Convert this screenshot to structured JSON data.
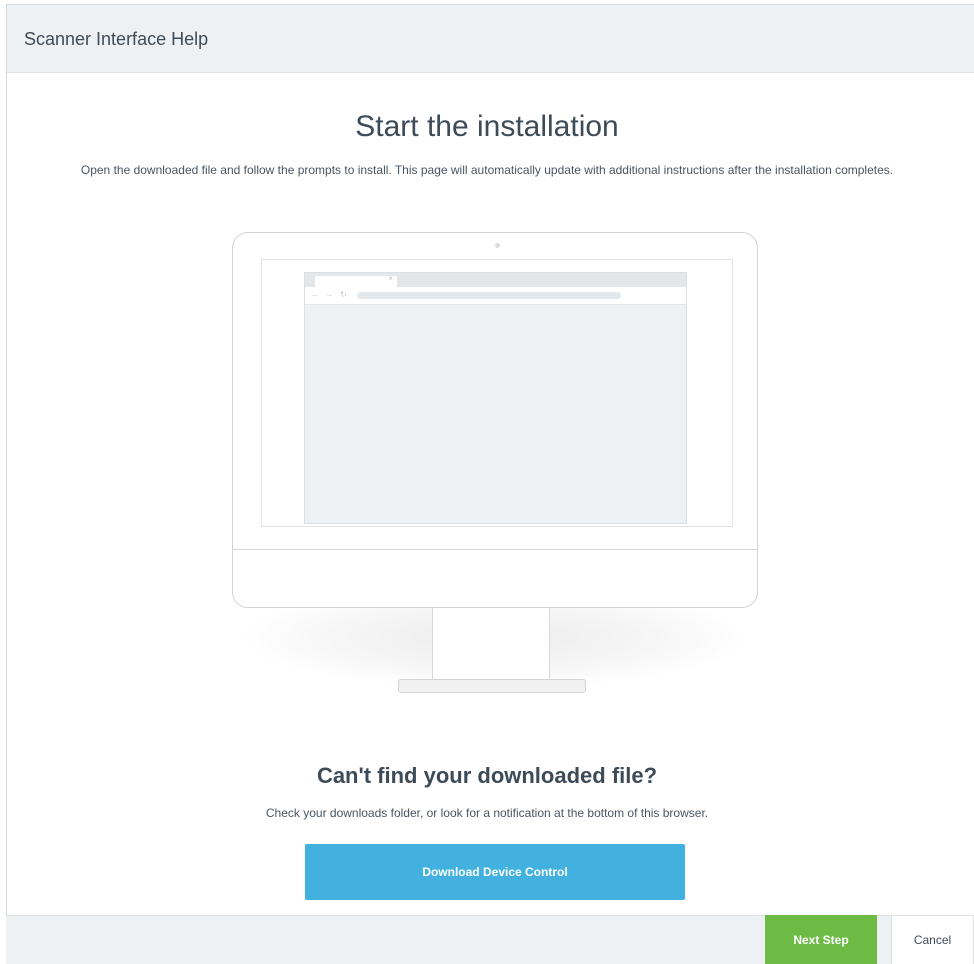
{
  "dialog": {
    "title": "Scanner Interface Help"
  },
  "main": {
    "title": "Start the installation",
    "intro": "Open the downloaded file and follow the prompts to install. This page will automatically update with additional instructions after the installation completes."
  },
  "illustration": {
    "icon": "monitor-with-browser",
    "tab_close_glyph": "×",
    "nav_back_glyph": "←",
    "nav_forward_glyph": "→",
    "nav_reload_glyph": "↻"
  },
  "help": {
    "title": "Can't find your downloaded file?",
    "text": "Check your downloads folder, or look for a notification at the bottom of this browser.",
    "download_label": "Download Device Control"
  },
  "footer": {
    "next_label": "Next Step",
    "cancel_label": "Cancel"
  },
  "colors": {
    "header_bg": "#eef1f4",
    "download_button": "#42b1e0",
    "next_button": "#6dbb45",
    "text": "#3d4b58"
  }
}
